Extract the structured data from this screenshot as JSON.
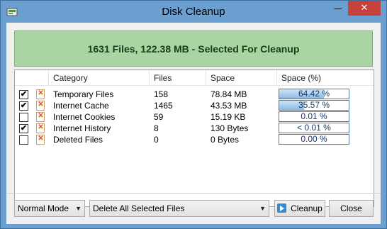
{
  "window": {
    "title": "Disk Cleanup"
  },
  "titlebar": {
    "minimize_glyph": "—",
    "close_glyph": "✕"
  },
  "banner": {
    "text": "1631 Files, 122.38 MB - Selected For Cleanup",
    "color": "#a8d5a2"
  },
  "list": {
    "columns": [
      "Category",
      "Files",
      "Space",
      "Space (%)"
    ],
    "rows": [
      {
        "checked": true,
        "category": "Temporary Files",
        "files": "158",
        "space": "78.84 MB",
        "percent_label": "64.42 %",
        "percent": 64.42
      },
      {
        "checked": true,
        "category": "Internet Cache",
        "files": "1465",
        "space": "43.53 MB",
        "percent_label": "35.57 %",
        "percent": 35.57
      },
      {
        "checked": false,
        "category": "Internet Cookies",
        "files": "59",
        "space": "15.19 KB",
        "percent_label": "0.01 %",
        "percent": 0.01
      },
      {
        "checked": true,
        "category": "Internet History",
        "files": "8",
        "space": "130 Bytes",
        "percent_label": "< 0.01 %",
        "percent": 0.0
      },
      {
        "checked": false,
        "category": "Deleted Files",
        "files": "0",
        "space": "0 Bytes",
        "percent_label": "0.00 %",
        "percent": 0.0
      }
    ]
  },
  "footer": {
    "mode_select": "Normal Mode",
    "action_select": "Delete All Selected Files",
    "cleanup_label": "Cleanup",
    "close_label": "Close"
  }
}
